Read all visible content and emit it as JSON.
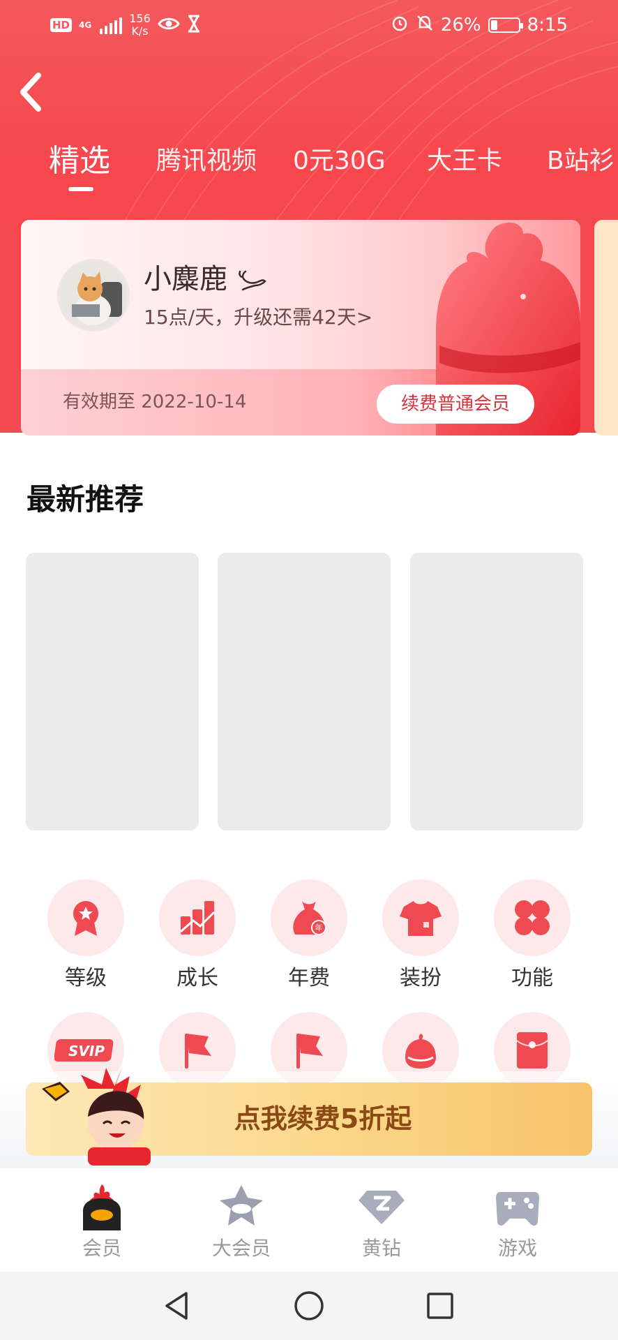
{
  "status_bar": {
    "hd": "HD",
    "network": "4G",
    "speed_value": "156",
    "speed_unit": "K/s",
    "battery": "26%",
    "time": "8:15"
  },
  "tabs": [
    {
      "label": "精选",
      "active": true
    },
    {
      "label": "腾讯视频"
    },
    {
      "label": "0元30G"
    },
    {
      "label": "大王卡"
    },
    {
      "label": "B站衫"
    }
  ],
  "member_card": {
    "nickname": "小麋鹿",
    "level_info": "15点/天，升级还需42天>",
    "expire": "有效期至 2022-10-14",
    "renew_button": "续费普通会员"
  },
  "latest": {
    "title": "最新推荐"
  },
  "grid": {
    "row1": [
      {
        "label": "等级",
        "icon": "medal-icon"
      },
      {
        "label": "成长",
        "icon": "growth-icon"
      },
      {
        "label": "年费",
        "icon": "annual-bag-icon"
      },
      {
        "label": "装扮",
        "icon": "tshirt-icon"
      },
      {
        "label": "功能",
        "icon": "clover-icon"
      }
    ],
    "row2_icons": [
      "svip-icon",
      "flag-icon",
      "flag-icon",
      "mascot-icon",
      "red-envelope-icon"
    ],
    "svip_text": "SVIP",
    "annual_badge": "年"
  },
  "promo": {
    "text": "点我续费5折起"
  },
  "bottom_nav": [
    {
      "label": "会员",
      "active": true
    },
    {
      "label": "大会员"
    },
    {
      "label": "黄钻"
    },
    {
      "label": "游戏"
    }
  ],
  "colors": {
    "brand_red": "#f4595c",
    "accent_text": "#d2343b",
    "promo_text": "#8b4a14"
  }
}
